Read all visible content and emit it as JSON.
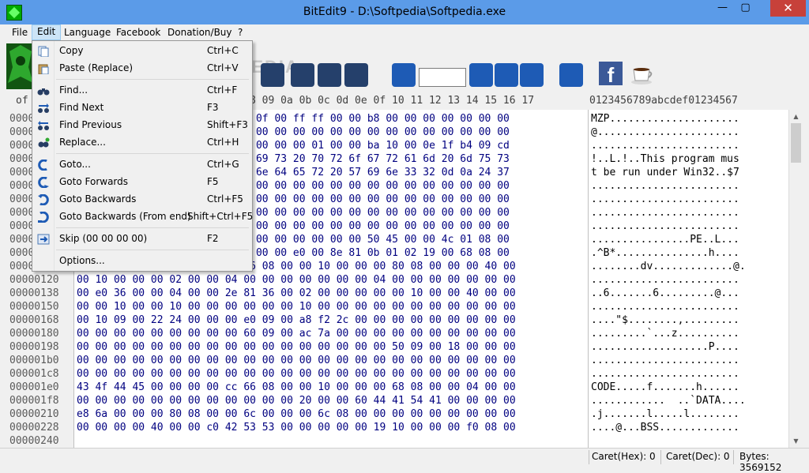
{
  "window": {
    "title": "BitEdit9 - D:\\Softpedia\\Softpedia.exe",
    "min_glyph": "—",
    "max_glyph": "▢",
    "close_glyph": "✕"
  },
  "menubar": [
    "File",
    "Edit",
    "Language",
    "Facebook",
    "Donation/Buy",
    "?"
  ],
  "edit_menu": [
    {
      "label": "Copy",
      "shortcut": "Ctrl+C",
      "icon": "copy-icon"
    },
    {
      "label": "Paste (Replace)",
      "shortcut": "Ctrl+V",
      "icon": "paste-icon"
    },
    {
      "label": "Find...",
      "shortcut": "Ctrl+F",
      "icon": "binoculars-icon"
    },
    {
      "label": "Find Next",
      "shortcut": "F3",
      "icon": "find-next-icon"
    },
    {
      "label": "Find Previous",
      "shortcut": "Shift+F3",
      "icon": "find-previous-icon"
    },
    {
      "label": "Replace...",
      "shortcut": "Ctrl+H",
      "icon": "replace-icon"
    },
    {
      "label": "Goto...",
      "shortcut": "Ctrl+G",
      "icon": "goto-icon"
    },
    {
      "label": "Goto Forwards",
      "shortcut": "F5",
      "icon": "goto-forwards-icon"
    },
    {
      "label": "Goto Backwards",
      "shortcut": "Ctrl+F5",
      "icon": "goto-backwards-icon"
    },
    {
      "label": "Goto Backwards (From end)",
      "shortcut": "Shift+Ctrl+F5",
      "icon": "goto-backwards-end-icon"
    },
    {
      "label": "Skip (00 00 00 00)",
      "shortcut": "F2",
      "icon": "skip-icon"
    },
    {
      "label": "Options...",
      "shortcut": "",
      "icon": ""
    }
  ],
  "header": {
    "offset": "of",
    "hex": "8 09 0a 0b 0c 0d 0e 0f 10 11 12 13 14 15 16 17",
    "ascii": "0123456789abcdef01234567"
  },
  "toolbar": {
    "goto_value": "",
    "watermark": "SOFTPEDIA",
    "facebook_glyph": "f"
  },
  "offsets": [
    "0000",
    "0000",
    "0000",
    "0000",
    "0000",
    "0000",
    "0000",
    "0000",
    "0000",
    "0000",
    "0000",
    "0000",
    "00000120",
    "00000138",
    "00000150",
    "00000168",
    "00000180",
    "00000198",
    "000001b0",
    "000001c8",
    "000001e0",
    "000001f8",
    "00000210",
    "00000228",
    "00000240"
  ],
  "hex_rows": [
    "                        4 00 0f 00 ff ff 00 00 b8 00 00 00 00 00 00 00",
    "                        0 00 00 00 00 00 00 00 00 00 00 00 00 00 00 00",
    "                        0 00 00 00 00 01 00 00 ba 10 00 0e 1f b4 09 cd",
    "                        4 68 69 73 20 70 72 6f 67 72 61 6d 20 6d 75 73",
    "                        0 75 6e 64 65 72 20 57 69 6e 33 32 0d 0a 24 37",
    "                        0 00 00 00 00 00 00 00 00 00 00 00 00 00 00 00",
    "                        0 00 00 00 00 00 00 00 00 00 00 00 00 00 00 00",
    "                        0 00 00 00 00 00 00 00 00 00 00 00 00 00 00 00",
    "                        0 00 00 00 00 00 00 00 00 00 00 00 00 00 00 00",
    "                        0 00 00 00 00 00 00 00 50 45 00 00 4c 01 08 00",
    "                        0 00 00 00 e0 00 8e 81 0b 01 02 19 00 68 08 00",
    "00 0a 2e 00 00 00 00 00 64 76 08 00 00 10 00 00 00 80 08 00 00 00 40 00",
    "00 10 00 00 00 02 00 00 04 00 00 00 00 00 00 00 04 00 00 00 00 00 00 00",
    "00 e0 36 00 00 04 00 00 2e 81 36 00 02 00 00 00 00 00 10 00 00 40 00 00",
    "00 00 10 00 00 10 00 00 00 00 00 00 10 00 00 00 00 00 00 00 00 00 00 00",
    "00 10 09 00 22 24 00 00 00 e0 09 00 a8 f2 2c 00 00 00 00 00 00 00 00 00",
    "00 00 00 00 00 00 00 00 00 60 09 00 ac 7a 00 00 00 00 00 00 00 00 00 00",
    "00 00 00 00 00 00 00 00 00 00 00 00 00 00 00 00 00 50 09 00 18 00 00 00",
    "00 00 00 00 00 00 00 00 00 00 00 00 00 00 00 00 00 00 00 00 00 00 00 00",
    "00 00 00 00 00 00 00 00 00 00 00 00 00 00 00 00 00 00 00 00 00 00 00 00",
    "43 4f 44 45 00 00 00 00 cc 66 08 00 00 10 00 00 00 68 08 00 00 04 00 00",
    "00 00 00 00 00 00 00 00 00 00 00 00 20 00 00 60 44 41 54 41 00 00 00 00",
    "e8 6a 00 00 00 80 08 00 00 6c 00 00 00 6c 08 00 00 00 00 00 00 00 00 00",
    "00 00 00 00 40 00 00 c0 42 53 53 00 00 00 00 00 19 10 00 00 00 f0 08 00"
  ],
  "ascii_rows": [
    "MZP.....................",
    "@.......................",
    "........................",
    "!..L.!..This program mus",
    "t be run under Win32..$7",
    "........................",
    "........................",
    "........................",
    "........................",
    "................PE..L...",
    ".^B*...............h....",
    "........dv.............@.",
    "........................",
    "..6.......6.........@...",
    "........................",
    "....\"$........,.........",
    ".........`...z..........",
    "...................P....",
    "........................",
    "........................",
    "CODE.....f.......h......",
    "............  ..`DATA....",
    ".j.......l.....l........",
    "....@...BSS.............",
    ""
  ],
  "status": {
    "caret_hex": "Caret(Hex): 0",
    "caret_dec": "Caret(Dec): 0",
    "bytes": "Bytes: 3569152"
  }
}
